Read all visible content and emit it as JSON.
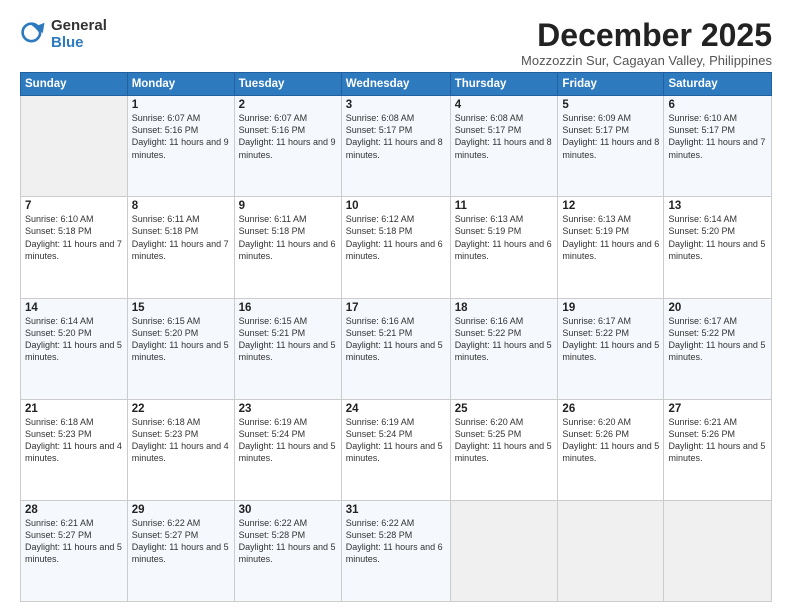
{
  "logo": {
    "general": "General",
    "blue": "Blue"
  },
  "title": "December 2025",
  "location": "Mozzozzin Sur, Cagayan Valley, Philippines",
  "days_header": [
    "Sunday",
    "Monday",
    "Tuesday",
    "Wednesday",
    "Thursday",
    "Friday",
    "Saturday"
  ],
  "weeks": [
    [
      {
        "day": "",
        "empty": true
      },
      {
        "day": "1",
        "sunrise": "6:07 AM",
        "sunset": "5:16 PM",
        "daylight": "11 hours and 9 minutes."
      },
      {
        "day": "2",
        "sunrise": "6:07 AM",
        "sunset": "5:16 PM",
        "daylight": "11 hours and 9 minutes."
      },
      {
        "day": "3",
        "sunrise": "6:08 AM",
        "sunset": "5:17 PM",
        "daylight": "11 hours and 8 minutes."
      },
      {
        "day": "4",
        "sunrise": "6:08 AM",
        "sunset": "5:17 PM",
        "daylight": "11 hours and 8 minutes."
      },
      {
        "day": "5",
        "sunrise": "6:09 AM",
        "sunset": "5:17 PM",
        "daylight": "11 hours and 8 minutes."
      },
      {
        "day": "6",
        "sunrise": "6:10 AM",
        "sunset": "5:17 PM",
        "daylight": "11 hours and 7 minutes."
      }
    ],
    [
      {
        "day": "7",
        "sunrise": "6:10 AM",
        "sunset": "5:18 PM",
        "daylight": "11 hours and 7 minutes."
      },
      {
        "day": "8",
        "sunrise": "6:11 AM",
        "sunset": "5:18 PM",
        "daylight": "11 hours and 7 minutes."
      },
      {
        "day": "9",
        "sunrise": "6:11 AM",
        "sunset": "5:18 PM",
        "daylight": "11 hours and 6 minutes."
      },
      {
        "day": "10",
        "sunrise": "6:12 AM",
        "sunset": "5:18 PM",
        "daylight": "11 hours and 6 minutes."
      },
      {
        "day": "11",
        "sunrise": "6:13 AM",
        "sunset": "5:19 PM",
        "daylight": "11 hours and 6 minutes."
      },
      {
        "day": "12",
        "sunrise": "6:13 AM",
        "sunset": "5:19 PM",
        "daylight": "11 hours and 6 minutes."
      },
      {
        "day": "13",
        "sunrise": "6:14 AM",
        "sunset": "5:20 PM",
        "daylight": "11 hours and 5 minutes."
      }
    ],
    [
      {
        "day": "14",
        "sunrise": "6:14 AM",
        "sunset": "5:20 PM",
        "daylight": "11 hours and 5 minutes."
      },
      {
        "day": "15",
        "sunrise": "6:15 AM",
        "sunset": "5:20 PM",
        "daylight": "11 hours and 5 minutes."
      },
      {
        "day": "16",
        "sunrise": "6:15 AM",
        "sunset": "5:21 PM",
        "daylight": "11 hours and 5 minutes."
      },
      {
        "day": "17",
        "sunrise": "6:16 AM",
        "sunset": "5:21 PM",
        "daylight": "11 hours and 5 minutes."
      },
      {
        "day": "18",
        "sunrise": "6:16 AM",
        "sunset": "5:22 PM",
        "daylight": "11 hours and 5 minutes."
      },
      {
        "day": "19",
        "sunrise": "6:17 AM",
        "sunset": "5:22 PM",
        "daylight": "11 hours and 5 minutes."
      },
      {
        "day": "20",
        "sunrise": "6:17 AM",
        "sunset": "5:22 PM",
        "daylight": "11 hours and 5 minutes."
      }
    ],
    [
      {
        "day": "21",
        "sunrise": "6:18 AM",
        "sunset": "5:23 PM",
        "daylight": "11 hours and 4 minutes."
      },
      {
        "day": "22",
        "sunrise": "6:18 AM",
        "sunset": "5:23 PM",
        "daylight": "11 hours and 4 minutes."
      },
      {
        "day": "23",
        "sunrise": "6:19 AM",
        "sunset": "5:24 PM",
        "daylight": "11 hours and 5 minutes."
      },
      {
        "day": "24",
        "sunrise": "6:19 AM",
        "sunset": "5:24 PM",
        "daylight": "11 hours and 5 minutes."
      },
      {
        "day": "25",
        "sunrise": "6:20 AM",
        "sunset": "5:25 PM",
        "daylight": "11 hours and 5 minutes."
      },
      {
        "day": "26",
        "sunrise": "6:20 AM",
        "sunset": "5:26 PM",
        "daylight": "11 hours and 5 minutes."
      },
      {
        "day": "27",
        "sunrise": "6:21 AM",
        "sunset": "5:26 PM",
        "daylight": "11 hours and 5 minutes."
      }
    ],
    [
      {
        "day": "28",
        "sunrise": "6:21 AM",
        "sunset": "5:27 PM",
        "daylight": "11 hours and 5 minutes."
      },
      {
        "day": "29",
        "sunrise": "6:22 AM",
        "sunset": "5:27 PM",
        "daylight": "11 hours and 5 minutes."
      },
      {
        "day": "30",
        "sunrise": "6:22 AM",
        "sunset": "5:28 PM",
        "daylight": "11 hours and 5 minutes."
      },
      {
        "day": "31",
        "sunrise": "6:22 AM",
        "sunset": "5:28 PM",
        "daylight": "11 hours and 6 minutes."
      },
      {
        "day": "",
        "empty": true
      },
      {
        "day": "",
        "empty": true
      },
      {
        "day": "",
        "empty": true
      }
    ]
  ]
}
